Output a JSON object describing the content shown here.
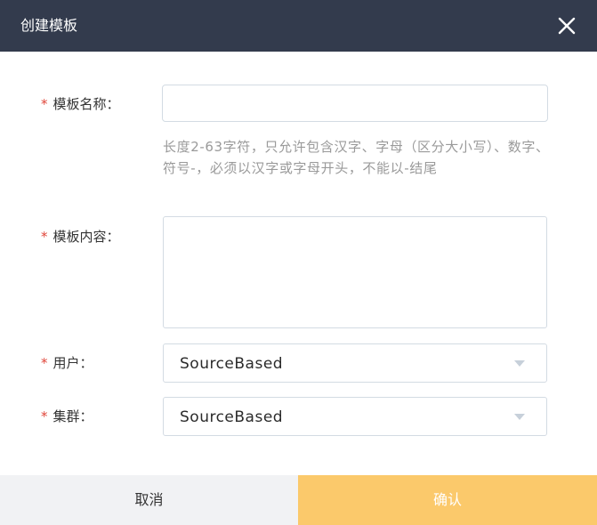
{
  "dialog": {
    "title": "创建模板"
  },
  "form": {
    "required_mark": "*",
    "template_name": {
      "label": "模板名称：",
      "value": "",
      "hint": "长度2-63字符，只允许包含汉字、字母（区分大小写）、数字、符号-，必须以汉字或字母开头，不能以-结尾"
    },
    "template_content": {
      "label": "模板内容：",
      "value": ""
    },
    "user": {
      "label": "用户：",
      "selected": "SourceBased"
    },
    "cluster": {
      "label": "集群：",
      "selected": "SourceBased"
    }
  },
  "footer": {
    "cancel_label": "取消",
    "confirm_label": "确认"
  },
  "colors": {
    "header_bg": "#333b4d",
    "required": "#e0463a",
    "confirm_bg": "#fbc96b",
    "cancel_bg": "#f1f2f4"
  }
}
